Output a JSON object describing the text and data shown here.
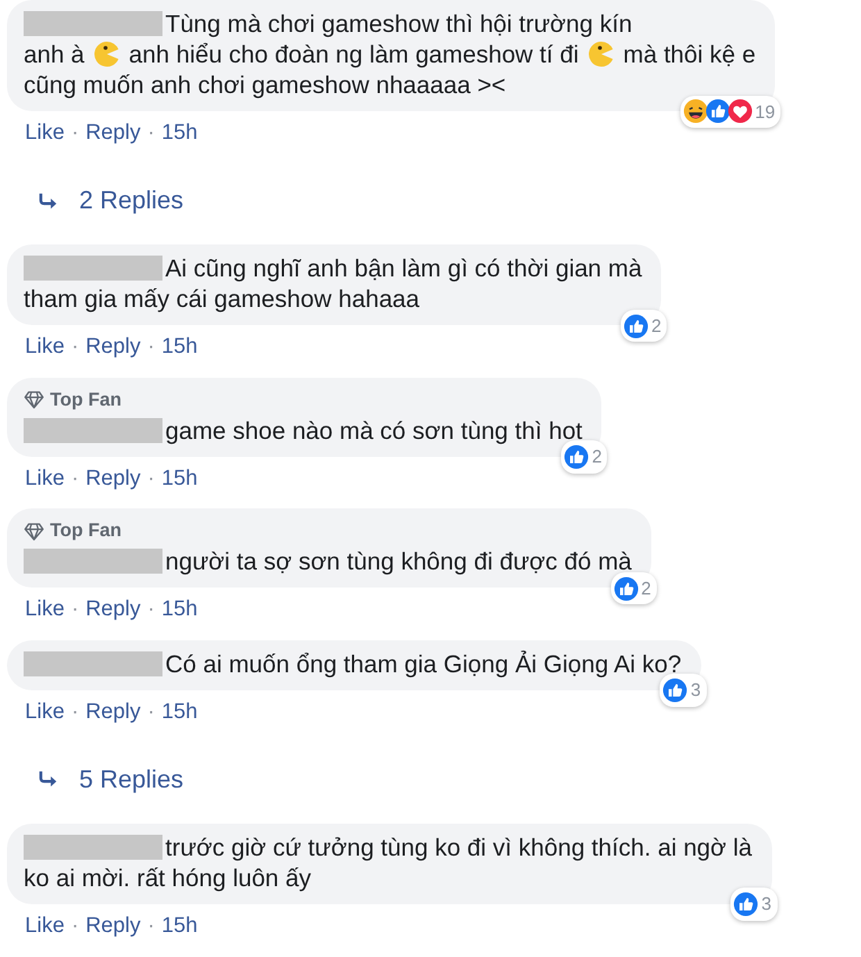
{
  "comments": [
    {
      "kind": "comment",
      "top_fan": false,
      "name_redacted": true,
      "lines": [
        [
          {
            "kind": "text",
            "text": "Tùng mà chơi gameshow thì hội trường kín"
          }
        ],
        [
          {
            "kind": "text",
            "text": "anh à"
          },
          {
            "kind": "emoji"
          },
          {
            "kind": "text",
            "text": "anh hiểu cho đoàn ng làm gameshow tí đi"
          },
          {
            "kind": "emoji"
          },
          {
            "kind": "text",
            "text": "mà thôi kệ e"
          }
        ],
        [
          {
            "kind": "text",
            "text": "cũng muốn anh chơi gameshow nhaaaaa ><"
          }
        ]
      ],
      "reactions": {
        "icons": [
          {
            "kind": "haha"
          },
          {
            "kind": "like"
          },
          {
            "kind": "love"
          }
        ],
        "count": "19"
      },
      "actions": [
        "Like",
        "Reply"
      ],
      "separator": "·",
      "time": "15h"
    },
    {
      "kind": "replies",
      "label": "2 Replies"
    },
    {
      "kind": "comment",
      "top_fan": false,
      "name_redacted": true,
      "lines": [
        [
          {
            "kind": "text",
            "text": "Ai cũng nghĩ anh bận làm gì có thời gian mà"
          }
        ],
        [
          {
            "kind": "text",
            "text": "tham gia mấy cái gameshow hahaaa"
          }
        ]
      ],
      "reactions": {
        "icons": [
          {
            "kind": "like"
          }
        ],
        "count": "2"
      },
      "actions": [
        "Like",
        "Reply"
      ],
      "separator": "·",
      "time": "15h"
    },
    {
      "kind": "comment",
      "top_fan": true,
      "badge": "Top Fan",
      "name_redacted": true,
      "lines": [
        [
          {
            "kind": "text",
            "text": "game shoe nào mà có sơn tùng thì hot"
          }
        ]
      ],
      "reactions": {
        "icons": [
          {
            "kind": "like"
          }
        ],
        "count": "2"
      },
      "actions": [
        "Like",
        "Reply"
      ],
      "separator": "·",
      "time": "15h"
    },
    {
      "kind": "comment",
      "top_fan": true,
      "badge": "Top Fan",
      "name_redacted": true,
      "lines": [
        [
          {
            "kind": "text",
            "text": "người ta sợ sơn tùng không đi được đó mà"
          }
        ]
      ],
      "reactions": {
        "icons": [
          {
            "kind": "like"
          }
        ],
        "count": "2"
      },
      "actions": [
        "Like",
        "Reply"
      ],
      "separator": "·",
      "time": "15h"
    },
    {
      "kind": "comment",
      "top_fan": false,
      "name_redacted": true,
      "lines": [
        [
          {
            "kind": "text",
            "text": "Có ai muốn ổng tham gia Giọng Ải Giọng Ai ko?"
          }
        ]
      ],
      "reactions": {
        "icons": [
          {
            "kind": "like"
          }
        ],
        "count": "3"
      },
      "actions": [
        "Like",
        "Reply"
      ],
      "separator": "·",
      "time": "15h"
    },
    {
      "kind": "replies",
      "label": "5 Replies"
    },
    {
      "kind": "comment",
      "top_fan": false,
      "name_redacted": true,
      "lines": [
        [
          {
            "kind": "text",
            "text": "trước giờ cứ tưởng tùng ko đi vì không thích. ai ngờ là"
          }
        ],
        [
          {
            "kind": "text",
            "text": "ko ai mời. rất hóng luôn ấy"
          }
        ]
      ],
      "reactions": {
        "icons": [
          {
            "kind": "like"
          }
        ],
        "count": "3"
      },
      "actions": [
        "Like",
        "Reply"
      ],
      "separator": "·",
      "time": "15h"
    }
  ]
}
